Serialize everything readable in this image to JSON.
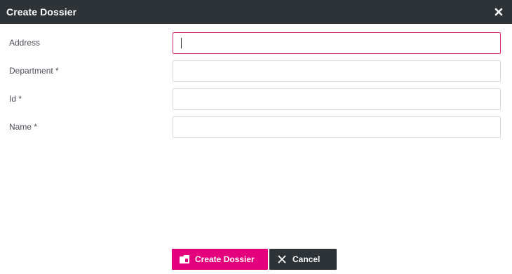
{
  "dialog": {
    "title": "Create Dossier"
  },
  "form": {
    "fields": [
      {
        "label": "Address",
        "value": "",
        "focused": true
      },
      {
        "label": "Department *",
        "value": ""
      },
      {
        "label": "Id *",
        "value": ""
      },
      {
        "label": "Name *",
        "value": ""
      }
    ]
  },
  "actions": {
    "create_label": "Create Dossier",
    "cancel_label": "Cancel"
  },
  "colors": {
    "titlebar": "#2e3338",
    "primary": "#e4007c",
    "focus_border": "#d4246e"
  },
  "icons": {
    "close": "close-icon",
    "create": "dossier-icon",
    "cancel": "x-icon"
  }
}
